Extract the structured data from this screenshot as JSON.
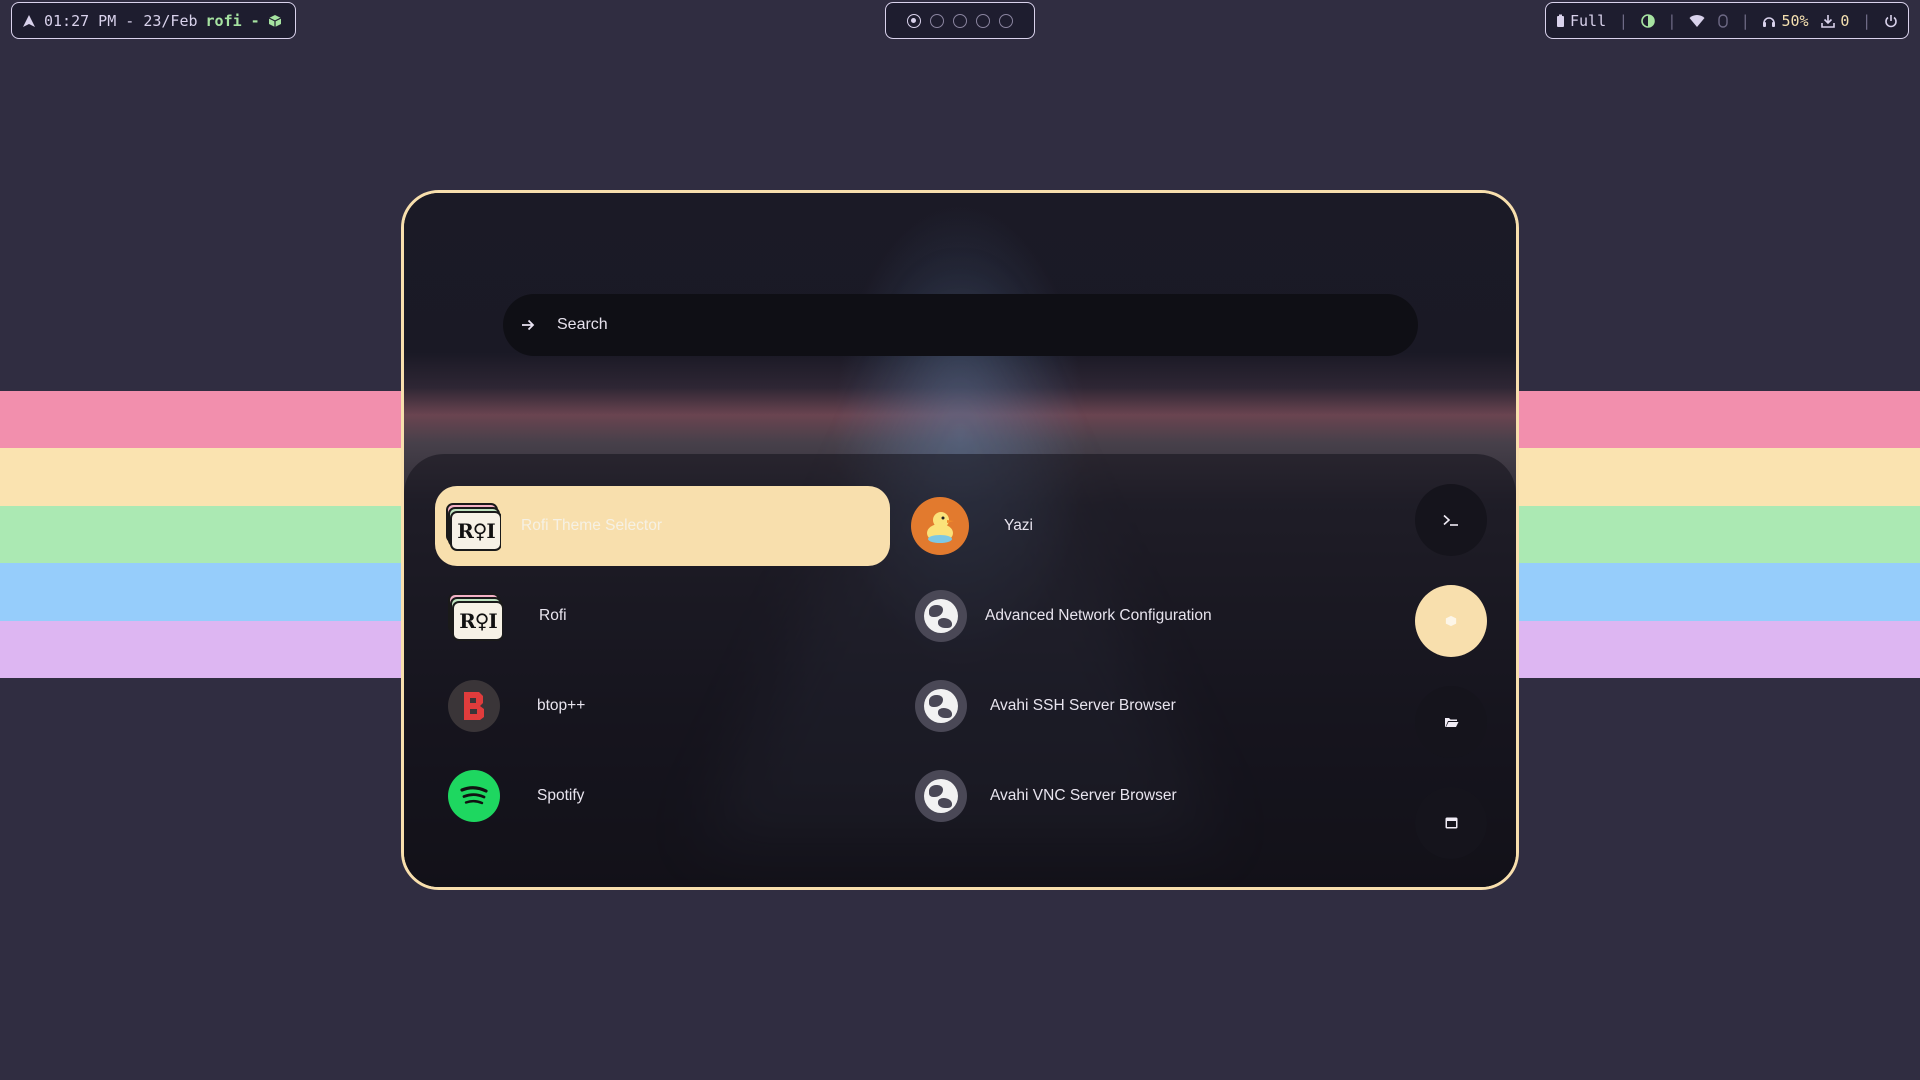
{
  "colors": {
    "background": "#302d41",
    "accent": "#f8dfad",
    "stripes": [
      "#f28fad",
      "#fae3b0",
      "#abe9b3",
      "#96cdfb",
      "#ddb6f2"
    ]
  },
  "topbar": {
    "left": {
      "launcher_icon": "arch-logo-icon",
      "clock": "01:27 PM - 23/Feb",
      "window_title": "rofi -",
      "window_icon": "package-icon"
    },
    "workspaces": [
      {
        "active": true
      },
      {
        "active": false
      },
      {
        "active": false
      },
      {
        "active": false
      },
      {
        "active": false
      }
    ],
    "right": {
      "battery_icon": "battery-icon",
      "battery": "Full",
      "brightness_icon": "brightness-icon",
      "wifi_icon": "wifi-icon",
      "bluetooth_icon": "bluetooth-icon",
      "volume_icon": "headphones-icon",
      "volume": "50%",
      "updates_icon": "download-icon",
      "updates": "0",
      "power_icon": "power-icon"
    }
  },
  "rofi": {
    "search": {
      "prompt_icon": "arrow-right-icon",
      "placeholder": "Search"
    },
    "entries": [
      {
        "label": "Rofi Theme Selector",
        "icon": "rofi-icon",
        "selected": true
      },
      {
        "label": "Yazi",
        "icon": "duck-icon",
        "selected": false
      },
      {
        "label": "Rofi",
        "icon": "rofi-icon",
        "selected": false
      },
      {
        "label": "Advanced Network Configuration",
        "icon": "globe-icon",
        "selected": false
      },
      {
        "label": "btop++",
        "icon": "btop-icon",
        "selected": false
      },
      {
        "label": "Avahi SSH Server Browser",
        "icon": "globe-icon",
        "selected": false
      },
      {
        "label": "Spotify",
        "icon": "spotify-icon",
        "selected": false
      },
      {
        "label": "Avahi VNC Server Browser",
        "icon": "globe-icon",
        "selected": false
      }
    ],
    "modes": [
      {
        "name": "terminal-mode",
        "icon": "terminal-icon",
        "active": false
      },
      {
        "name": "apps-mode",
        "icon": "package-icon",
        "active": true
      },
      {
        "name": "files-mode",
        "icon": "folder-icon",
        "active": false
      },
      {
        "name": "windows-mode",
        "icon": "window-icon",
        "active": false
      }
    ]
  }
}
